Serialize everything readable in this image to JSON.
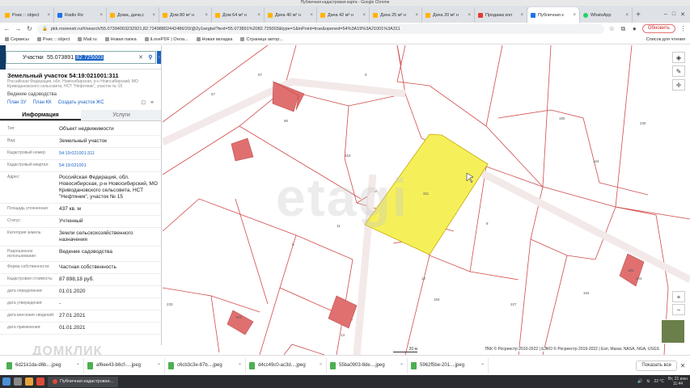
{
  "window": {
    "title": "Публичная кадастровая карта - Google Chrome"
  },
  "tabs": [
    {
      "label": "Рнис :: object",
      "icon": "y"
    },
    {
      "label": "Radio Re",
      "icon": "g"
    },
    {
      "label": "Дома, дачи,с",
      "icon": "y"
    },
    {
      "label": "Дом 80 м² н",
      "icon": "y"
    },
    {
      "label": "Дом 64 м² н",
      "icon": "y"
    },
    {
      "label": "Дача 40 м² н",
      "icon": "y"
    },
    {
      "label": "Дача 42 м² н",
      "icon": "y"
    },
    {
      "label": "Дача 25 м² н",
      "icon": "y"
    },
    {
      "label": "Дача 20 м² н",
      "icon": "y"
    },
    {
      "label": "Продажа кол",
      "icon": "r"
    },
    {
      "label": "Публичная к",
      "icon": "g",
      "active": true
    },
    {
      "label": "WhatsApp",
      "icon": "w"
    }
  ],
  "nav": {
    "url": "pkk.rosreestr.ru/#/search/55.07394003232921,82.72498802442486/20/@2y1wrgtwl?text=55.073891%2082.725003&type=1&inPoint=true&opened=54%3A19%3A21001%3A311",
    "update_label": "Обновить"
  },
  "bookmarks": [
    "Сервисы",
    "Рнис :: object",
    "Mail.ru",
    "Новая папка",
    "iLovePDF | Онла...",
    "Новая вкладка",
    "Страница автор..."
  ],
  "reading_list": "Список для чтения",
  "search": {
    "type": "Участки",
    "query_plain": "55.073891 ",
    "query_selected": "82.725003"
  },
  "object": {
    "title": "Земельный участок 54:19:021001:311",
    "address": "Российская Федерация, обл. Новосибирская, р-н Новосибирский, МО Криводановского сельсовета, НСТ \"Нефтяник\", участок № 15",
    "status": "Ведение садоводства",
    "links": [
      "План ЗУ",
      "План КК",
      "Создать участок ЖС"
    ]
  },
  "panel_tabs": [
    "Информация",
    "Услуги"
  ],
  "props": [
    {
      "label": "Тип:",
      "value": "Объект недвижимости"
    },
    {
      "label": "Вид:",
      "value": "Земельный участок"
    },
    {
      "label": "Кадастровый номер:",
      "value": "54:19:021001:311",
      "link": true
    },
    {
      "label": "Кадастровый квартал:",
      "value": "54:19:021001",
      "link": true
    },
    {
      "label": "Адрес:",
      "value": "Российская Федерация, обл. Новосибирская, р-н Новосибирский, МО Криводановского сельсовета, НСТ \"Нефтяник\", участок № 15"
    },
    {
      "label": "Площадь уточненная:",
      "value": "437 кв. м"
    },
    {
      "label": "Статус:",
      "value": "Учтенный"
    },
    {
      "label": "Категория земель:",
      "value": "Земли сельскохозяйственного назначения"
    },
    {
      "label": "Разрешенное использование:",
      "value": "Ведение садоводства"
    },
    {
      "label": "Форма собственности:",
      "value": "Частная собственность"
    },
    {
      "label": "Кадастровая стоимость:",
      "value": "87 898,18 руб."
    },
    {
      "label": "дата определения:",
      "value": "01.01.2020"
    },
    {
      "label": "дата утверждения:",
      "value": "-"
    },
    {
      "label": "дата внесения сведений:",
      "value": "27.01.2021"
    },
    {
      "label": "дата применения:",
      "value": "01.01.2021"
    }
  ],
  "map": {
    "watermark": "etagi",
    "domclick": "ДОМКЛИК",
    "attribution": "ПКК © Росреестр 2010-2022 | ЕЭКО © Росреестр 2019-2022 | Esri, Maxar, NASA, NGA, USGS",
    "scale": "20 м",
    "parcel_labels": [
      "87",
      "67",
      "96",
      "9",
      "163",
      "311",
      "11",
      "160",
      "230",
      "8",
      "164",
      "6",
      "12",
      "181",
      "164",
      "233",
      "13",
      "193",
      "184",
      "144",
      "227"
    ],
    "highlight_color": "#f5f05a",
    "building_color": "#e07070"
  },
  "downloads": [
    "6d21k1da-d6b....jpeg",
    "af6ee43-b6cf-....jpeg",
    "c6cb3c3e-87b....jpeg",
    "d4cc49c0-ac3d....jpeg",
    "55ba0903-8de....jpeg",
    "5962f5be-201....jpeg"
  ],
  "downloads_show_all": "Показать все",
  "taskbar": {
    "window": "Публичная кадастровая...",
    "temp": "22 °C",
    "date": "Вт, 21 июн",
    "time": "11:44"
  }
}
